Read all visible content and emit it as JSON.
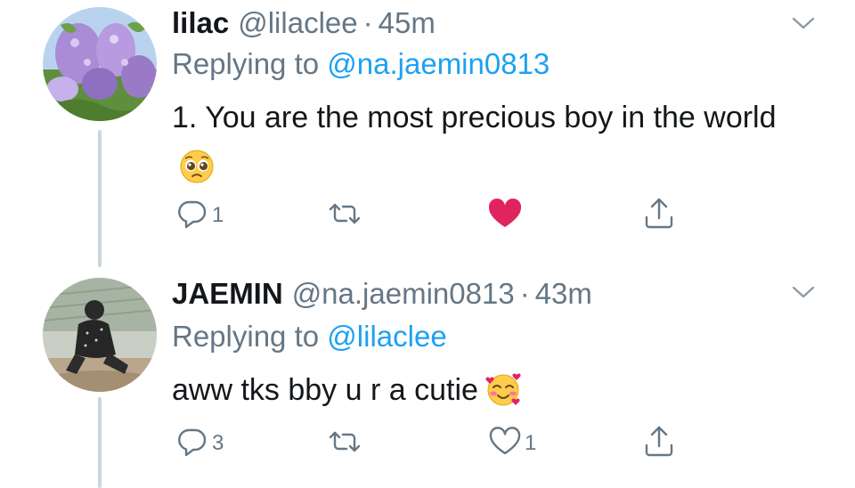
{
  "tweets": [
    {
      "display_name": "lilac",
      "handle": "@lilaclee",
      "separator": "·",
      "time": "45m",
      "replying_prefix": "Replying to",
      "replying_to": "@na.jaemin0813",
      "text": "1. You are the most precious boy in the world",
      "emoji": "pleading-face-emoji",
      "avatar": "lilac-flowers-photo",
      "reply_count": "1",
      "retweet_count": "",
      "like_count": "",
      "liked": true,
      "icons": {
        "reply": "reply-icon",
        "retweet": "retweet-icon",
        "like": "heart-filled-icon",
        "share": "share-icon",
        "caret": "chevron-down-icon"
      },
      "colors": {
        "like": "#e0245e"
      }
    },
    {
      "display_name": "JAEMIN",
      "handle": "@na.jaemin0813",
      "separator": "·",
      "time": "43m",
      "replying_prefix": "Replying to",
      "replying_to": "@lilaclee",
      "text": "aww tks bby u r a cutie",
      "emoji": "smiling-face-with-hearts-emoji",
      "avatar": "person-sitting-photo",
      "reply_count": "3",
      "retweet_count": "",
      "like_count": "1",
      "liked": false,
      "icons": {
        "reply": "reply-icon",
        "retweet": "retweet-icon",
        "like": "heart-outline-icon",
        "share": "share-icon",
        "caret": "chevron-down-icon"
      },
      "colors": {
        "like": "#657786"
      }
    }
  ],
  "colors": {
    "link": "#1da1f2",
    "secondary": "#657786",
    "text": "#14171a",
    "thread_line": "#ccd6dd"
  }
}
